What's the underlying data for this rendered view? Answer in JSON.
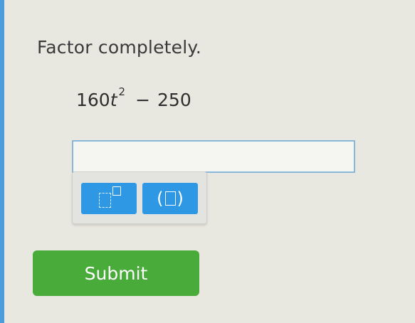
{
  "question": {
    "prompt": "Factor completely.",
    "expression": {
      "coefficient": "160",
      "variable": "t",
      "exponent": "2",
      "operator": "−",
      "constant": "250"
    }
  },
  "answer": {
    "value": "",
    "placeholder": ""
  },
  "palette": {
    "buttons": [
      {
        "name": "exponent-template",
        "icon": "superscript-box-icon"
      },
      {
        "name": "parentheses-template",
        "icon": "parentheses-box-icon"
      }
    ]
  },
  "submit": {
    "label": "Submit"
  },
  "colors": {
    "background": "#e9e8e0",
    "palette_button": "#2f98e4",
    "submit_button": "#49ac3a",
    "input_border": "#88b8da",
    "accent_edge": "#2e8fd8"
  }
}
